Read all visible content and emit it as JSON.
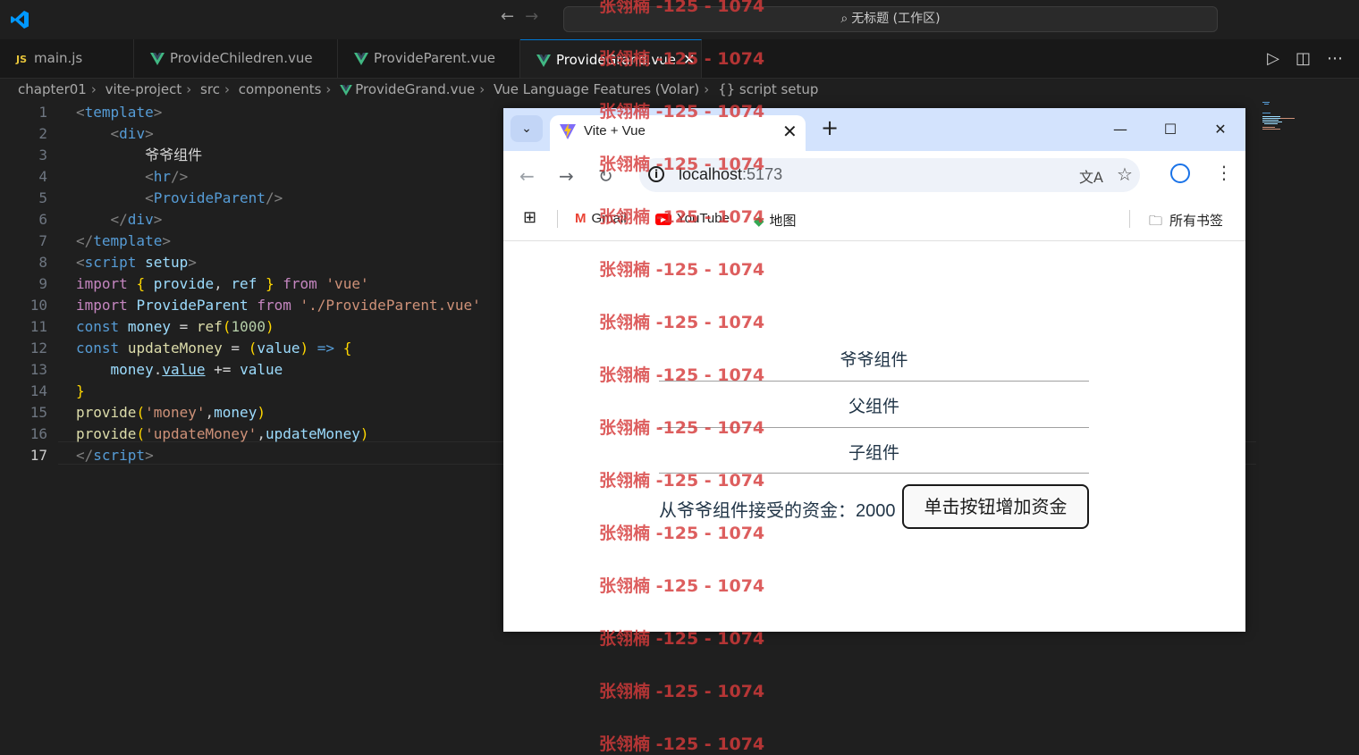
{
  "titlebar": {
    "search_text": "无标题 (工作区)"
  },
  "tabs": [
    {
      "label": "main.js",
      "type": "js",
      "active": false
    },
    {
      "label": "ProvideChiledren.vue",
      "type": "vue",
      "active": false
    },
    {
      "label": "ProvideParent.vue",
      "type": "vue",
      "active": false
    },
    {
      "label": "ProvideGrand.vue",
      "type": "vue",
      "active": true
    }
  ],
  "breadcrumb": {
    "items": [
      "chapter01",
      "vite-project",
      "src",
      "components",
      "ProvideGrand.vue",
      "Vue Language Features (Volar)",
      "{} script setup"
    ]
  },
  "editor": {
    "current_line": 17,
    "line_numbers": [
      "1",
      "2",
      "3",
      "4",
      "5",
      "6",
      "7",
      "8",
      "9",
      "10",
      "11",
      "12",
      "13",
      "14",
      "15",
      "16",
      "17"
    ]
  },
  "browser": {
    "tab_title": "Vite + Vue",
    "url_host": "localhost",
    "url_port": ":5173",
    "bookmarks": [
      "Gmail",
      "YouTube",
      "地图"
    ],
    "all_bookmarks": "所有书签",
    "page": {
      "grand_label": "爷爷组件",
      "parent_label": "父组件",
      "child_label": "子组件",
      "money_text": "从爷爷组件接受的资金：2000",
      "button_label": "单击按钮增加资金"
    }
  },
  "watermark": {
    "text": "张翎楠 -125 - 1074"
  },
  "colors": {
    "editor_bg": "#1f1f1f",
    "accent": "#0078d4",
    "vue_green": "#41b883",
    "watermark": "#d63a3a",
    "chrome_tabstrip": "#d3e3fd"
  }
}
